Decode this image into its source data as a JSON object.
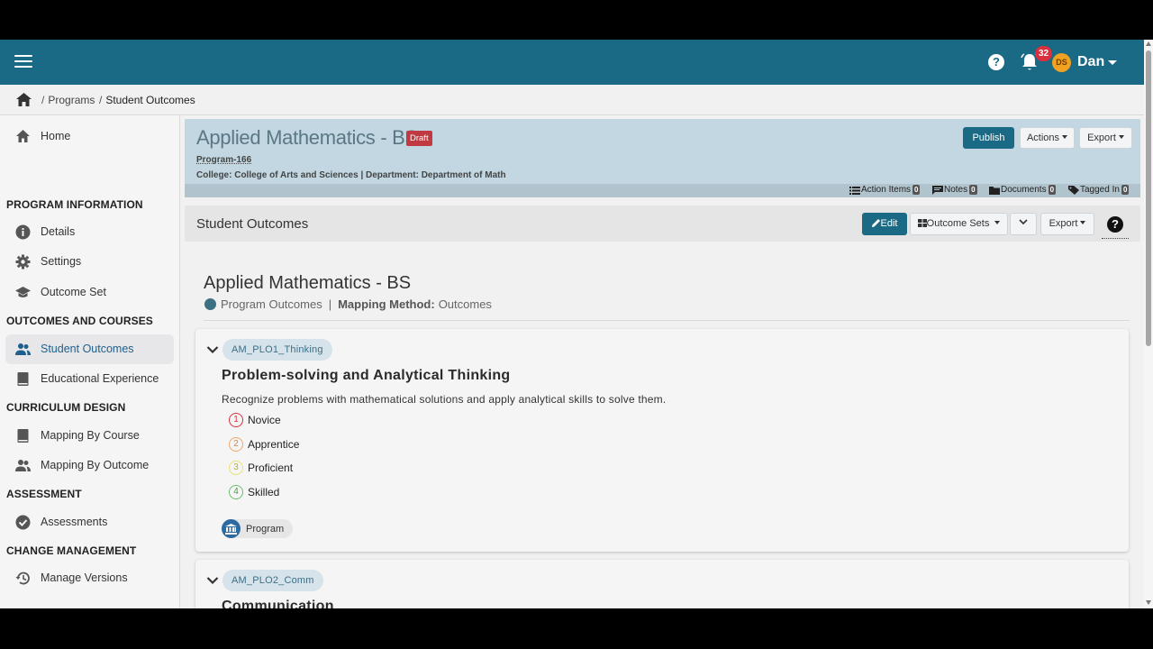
{
  "topbar": {
    "notification_count": "32",
    "user_initials": "DS",
    "user_name": "Dan",
    "help_glyph": "?"
  },
  "breadcrumb": {
    "items": [
      "Programs",
      "Student Outcomes"
    ]
  },
  "sidebar": {
    "home": "Home",
    "sections": [
      {
        "title": "PROGRAM INFORMATION",
        "items": [
          "Details",
          "Settings",
          "Outcome Set"
        ]
      },
      {
        "title": "OUTCOMES AND COURSES",
        "items": [
          "Student Outcomes",
          "Educational Experience"
        ]
      },
      {
        "title": "CURRICULUM DESIGN",
        "items": [
          "Mapping By Course",
          "Mapping By Outcome"
        ]
      },
      {
        "title": "ASSESSMENT",
        "items": [
          "Assessments"
        ]
      },
      {
        "title": "CHANGE MANAGEMENT",
        "items": [
          "Manage Versions"
        ]
      }
    ],
    "active": "Student Outcomes"
  },
  "program": {
    "title": "Applied Mathematics - BS",
    "status": "Draft",
    "id": "Program-166",
    "college_line": "College: College of Arts and Sciences | Department: Department of Math",
    "buttons": {
      "publish": "Publish",
      "actions": "Actions",
      "export": "Export"
    },
    "footer": [
      {
        "label": "Action Items",
        "count": "0"
      },
      {
        "label": "Notes",
        "count": "0"
      },
      {
        "label": "Documents",
        "count": "0"
      },
      {
        "label": "Tagged In",
        "count": "0"
      }
    ]
  },
  "section": {
    "title": "Student Outcomes",
    "edit": "Edit",
    "outcome_sets": "Outcome Sets",
    "export": "Export",
    "help_glyph": "?"
  },
  "main": {
    "title": "Applied Mathematics - BS",
    "outcome_type": "Program Outcomes",
    "separator": "|",
    "mapping_label": "Mapping Method:",
    "mapping_value": "Outcomes"
  },
  "outcomes": [
    {
      "code": "AM_PLO1_Thinking",
      "title": "Problem-solving and Analytical Thinking",
      "description": "Recognize problems with mathematical solutions and apply analytical skills to solve them.",
      "levels": [
        {
          "num": "1",
          "label": "Novice",
          "color": "#d9303e"
        },
        {
          "num": "2",
          "label": "Apprentice",
          "color": "#f0a86a"
        },
        {
          "num": "3",
          "label": "Proficient",
          "color": "#e9e07a"
        },
        {
          "num": "4",
          "label": "Skilled",
          "color": "#6cbf6c"
        }
      ],
      "scope": "Program"
    },
    {
      "code": "AM_PLO2_Comm",
      "title": "Communication"
    }
  ],
  "colors": {
    "brand": "#1a6a86",
    "draft": "#c23a41",
    "header_bg": "#c2d7e1"
  }
}
